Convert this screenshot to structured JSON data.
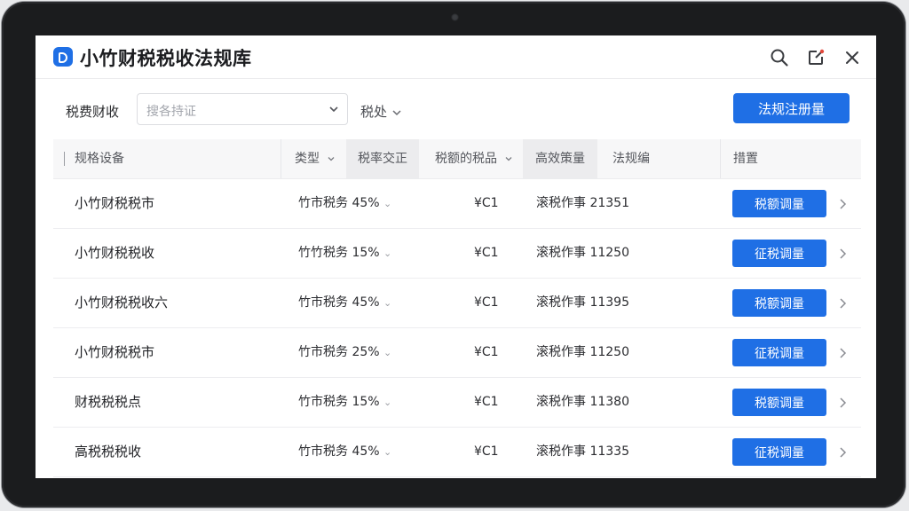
{
  "app": {
    "title": "小竹财税税收法规库"
  },
  "titlebar_icons": [
    "search-icon",
    "share-icon",
    "close-icon"
  ],
  "toolbar": {
    "filter_label": "税费财收",
    "search_placeholder": "搜各持证",
    "type_filter": "税处",
    "primary_button": "法规注册量"
  },
  "table": {
    "columns": [
      "规格设备",
      "类型",
      "税率交正",
      "税额的税品",
      "高效策量",
      "法规编",
      "措置"
    ],
    "rows": [
      {
        "name": "小竹财税税市",
        "rate": "竹市税务 45%",
        "amount": "¥C1",
        "code": "滚税作事 21351",
        "action": "税额调量"
      },
      {
        "name": "小竹财税税收",
        "rate": "竹竹税务 15%",
        "amount": "¥C1",
        "code": "滚税作事 11250",
        "action": "征税调量"
      },
      {
        "name": "小竹财税税收六",
        "rate": "竹市税务 45%",
        "amount": "¥C1",
        "code": "滚税作事 11395",
        "action": "税额调量"
      },
      {
        "name": "小竹财税税市",
        "rate": "竹市税务 25%",
        "amount": "¥C1",
        "code": "滚税作事 11250",
        "action": "征税调量"
      },
      {
        "name": "财税税税点",
        "rate": "竹市税务 15%",
        "amount": "¥C1",
        "code": "滚税作事 11380",
        "action": "税额调量"
      },
      {
        "name": "高税税税收",
        "rate": "竹市税务 45%",
        "amount": "¥C1",
        "code": "滚税作事 11335",
        "action": "征税调量"
      }
    ]
  },
  "colors": {
    "accent": "#1f6fe5",
    "header_bg": "#f7f7f8",
    "bezel": "#1b1c1e"
  }
}
